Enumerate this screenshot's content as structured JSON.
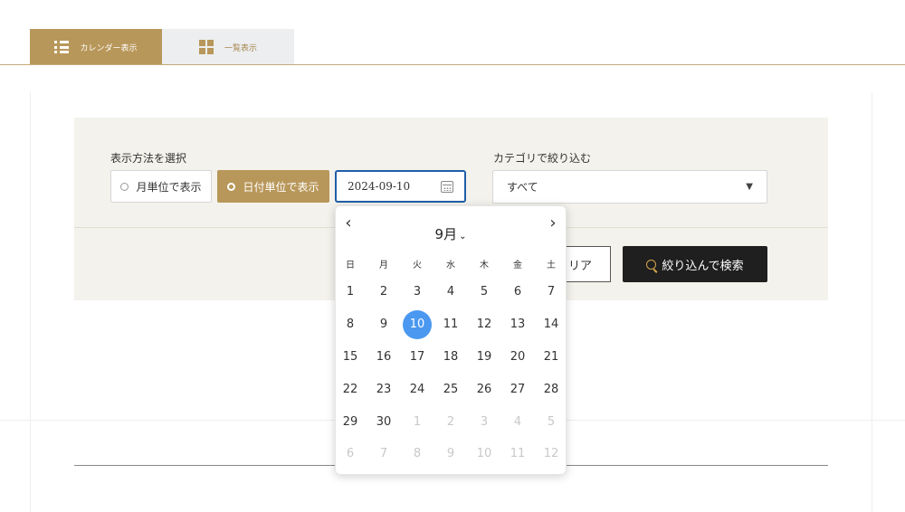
{
  "tabs": [
    {
      "label": "カレンダー表示",
      "icon": "list-icon",
      "active": true
    },
    {
      "label": "一覧表示",
      "icon": "grid-icon",
      "active": false
    }
  ],
  "filter": {
    "display_label": "表示方法を選択",
    "option_month": "月単位で表示",
    "option_day": "日付単位で表示",
    "selected_option": "option_day",
    "date_value": "2024-09-10",
    "category_label": "カテゴリで絞り込む",
    "category_value": "すべて",
    "clear_label_visible": "リア",
    "search_label": "絞り込んで検索"
  },
  "datepicker": {
    "month_label": "9月",
    "weekdays": [
      "日",
      "月",
      "火",
      "水",
      "木",
      "金",
      "土"
    ],
    "days": [
      {
        "d": "1",
        "m": "cur"
      },
      {
        "d": "2",
        "m": "cur"
      },
      {
        "d": "3",
        "m": "cur"
      },
      {
        "d": "4",
        "m": "cur"
      },
      {
        "d": "5",
        "m": "cur"
      },
      {
        "d": "6",
        "m": "cur"
      },
      {
        "d": "7",
        "m": "cur"
      },
      {
        "d": "8",
        "m": "cur"
      },
      {
        "d": "9",
        "m": "cur"
      },
      {
        "d": "10",
        "m": "cur",
        "selected": true
      },
      {
        "d": "11",
        "m": "cur"
      },
      {
        "d": "12",
        "m": "cur"
      },
      {
        "d": "13",
        "m": "cur"
      },
      {
        "d": "14",
        "m": "cur"
      },
      {
        "d": "15",
        "m": "cur"
      },
      {
        "d": "16",
        "m": "cur"
      },
      {
        "d": "17",
        "m": "cur"
      },
      {
        "d": "18",
        "m": "cur"
      },
      {
        "d": "19",
        "m": "cur"
      },
      {
        "d": "20",
        "m": "cur"
      },
      {
        "d": "21",
        "m": "cur"
      },
      {
        "d": "22",
        "m": "cur"
      },
      {
        "d": "23",
        "m": "cur"
      },
      {
        "d": "24",
        "m": "cur"
      },
      {
        "d": "25",
        "m": "cur"
      },
      {
        "d": "26",
        "m": "cur"
      },
      {
        "d": "27",
        "m": "cur"
      },
      {
        "d": "28",
        "m": "cur"
      },
      {
        "d": "29",
        "m": "cur"
      },
      {
        "d": "30",
        "m": "cur"
      },
      {
        "d": "1",
        "m": "next"
      },
      {
        "d": "2",
        "m": "next"
      },
      {
        "d": "3",
        "m": "next"
      },
      {
        "d": "4",
        "m": "next"
      },
      {
        "d": "5",
        "m": "next"
      },
      {
        "d": "6",
        "m": "next"
      },
      {
        "d": "7",
        "m": "next"
      },
      {
        "d": "8",
        "m": "next"
      },
      {
        "d": "9",
        "m": "next"
      },
      {
        "d": "10",
        "m": "next"
      },
      {
        "d": "11",
        "m": "next"
      },
      {
        "d": "12",
        "m": "next"
      }
    ]
  },
  "colors": {
    "accent": "#b8975a",
    "selected_day": "#4a98f0",
    "focus_border": "#1f5fa8",
    "dark_button": "#1f1f1f"
  }
}
